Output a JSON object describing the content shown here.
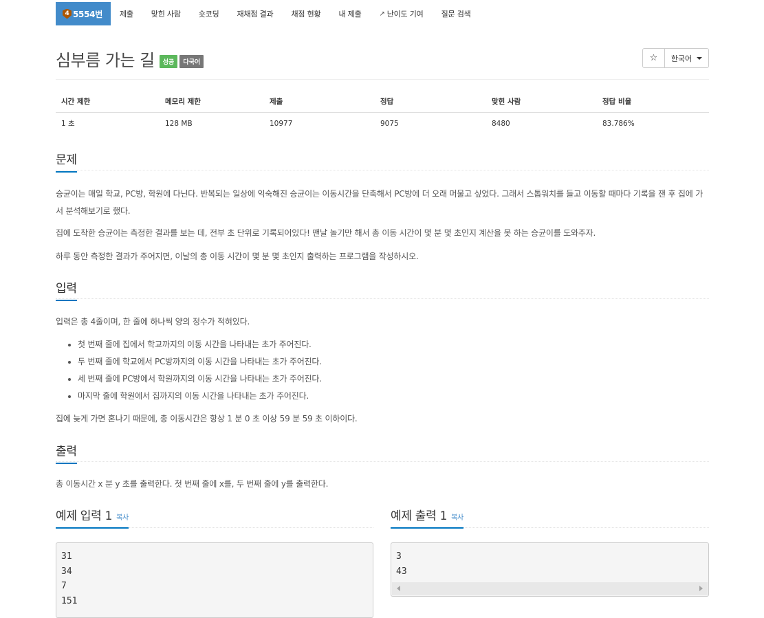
{
  "nav": {
    "problem_tier": "4",
    "problem_label": "5554번",
    "items": [
      "제출",
      "맞힌 사람",
      "숏코딩",
      "재채점 결과",
      "채점 현황",
      "내 제출",
      "난이도 기여",
      "질문 검색"
    ]
  },
  "problem": {
    "title": "심부름 가는 길",
    "labels": [
      "성공",
      "다국어"
    ],
    "star": "☆",
    "language": "한국어"
  },
  "info": {
    "headers": [
      "시간 제한",
      "메모리 제한",
      "제출",
      "정답",
      "맞힌 사람",
      "정답 비율"
    ],
    "values": [
      "1 초",
      "128 MB",
      "10977",
      "9075",
      "8480",
      "83.786%"
    ]
  },
  "sections": {
    "problem": {
      "title": "문제",
      "paragraphs": [
        "승균이는 매일 학교, PC방, 학원에 다닌다. 반복되는 일상에 익숙해진 승균이는 이동시간을 단축해서 PC방에 더 오래 머물고 싶었다. 그래서 스톱워치를 들고 이동할 때마다 기록을 잰 후 집에 가서 분석해보기로 했다.",
        "집에 도착한 승균이는 측정한 결과를 보는 데, 전부 초 단위로 기록되어있다! 맨날 놀기만 해서 총 이동 시간이 몇 분 몇 초인지 계산을 못 하는 승균이를 도와주자.",
        "하루 동안 측정한 결과가 주어지면, 이날의 총 이동 시간이 몇 분 몇 초인지 출력하는 프로그램을 작성하시오."
      ]
    },
    "input": {
      "title": "입력",
      "intro": "입력은 총 4줄이며, 한 줄에 하나씩 양의 정수가 적혀있다.",
      "bullets": [
        "첫 번째 줄에 집에서 학교까지의 이동 시간을 나타내는 초가 주어진다.",
        "두 번째 줄에 학교에서 PC방까지의 이동 시간을 나타내는 초가 주어진다.",
        "세 번째 줄에 PC방에서 학원까지의 이동 시간을 나타내는 초가 주어진다.",
        "마지막 줄에 학원에서 집까지의 이동 시간을 나타내는 초가 주어진다."
      ],
      "outro": "집에 늦게 가면 혼나기 때문에, 총 이동시간은 항상 1 분 0 초 이상 59 분 59 초 이하이다."
    },
    "output": {
      "title": "출력",
      "text": "총 이동시간 x 분 y 초를 출력한다. 첫 번째 줄에 x를, 두 번째 줄에 y를 출력한다."
    }
  },
  "samples": {
    "input_title": "예제 입력 1",
    "output_title": "예제 출력 1",
    "copy_label": "복사",
    "input_lines": [
      "31",
      "34",
      "7",
      "151"
    ],
    "output_lines": [
      "3",
      "43"
    ]
  },
  "colors": {
    "nav_active": "#428bca",
    "success": "#5cb85c",
    "default_label": "#777777",
    "section_underline": "#0076c0",
    "tier_bronze": "#ad5600"
  }
}
